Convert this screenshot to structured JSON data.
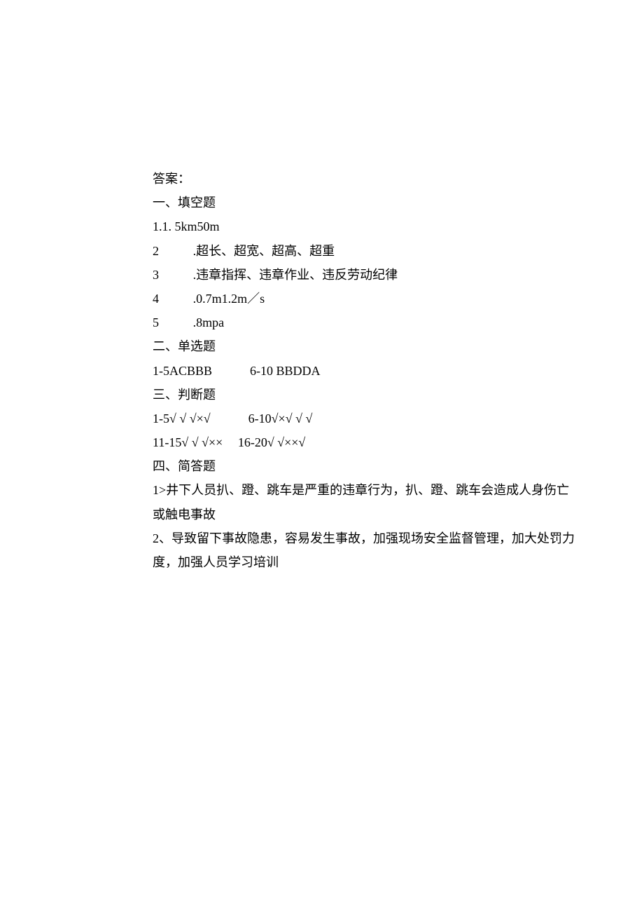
{
  "answers_label": "答案：",
  "section1": {
    "title": "一、填空题",
    "items": [
      {
        "num": "1.",
        "text": "1.  5km50m"
      },
      {
        "num": "2",
        "text": ".超长、超宽、超高、超重"
      },
      {
        "num": "3",
        "text": ".违章指挥、违章作业、违反劳动纪律"
      },
      {
        "num": "4",
        "text": ".0.7m1.2m／s"
      },
      {
        "num": "5",
        "text": ".8mpa"
      }
    ]
  },
  "section2": {
    "title": "二、单选题",
    "left": "1-5ACBBB",
    "right": "6-10 BBDDA"
  },
  "section3": {
    "title": "三、判断题",
    "row1_left": "1-5√ √ √×√",
    "row1_right": "6-10√×√ √ √",
    "row2_left": "11-15√ √ √××",
    "row2_right": "16-20√ √××√"
  },
  "section4": {
    "title": "四、简答题",
    "a1_line1": "1>井下人员扒、蹬、跳车是严重的违章行为，扒、蹬、跳车会造成人身伤亡",
    "a1_line2": "或触电事故",
    "a2_line1": "2、导致留下事故隐患，容易发生事故，加强现场安全监督管理，加大处罚力",
    "a2_line2": "度，加强人员学习培训"
  }
}
